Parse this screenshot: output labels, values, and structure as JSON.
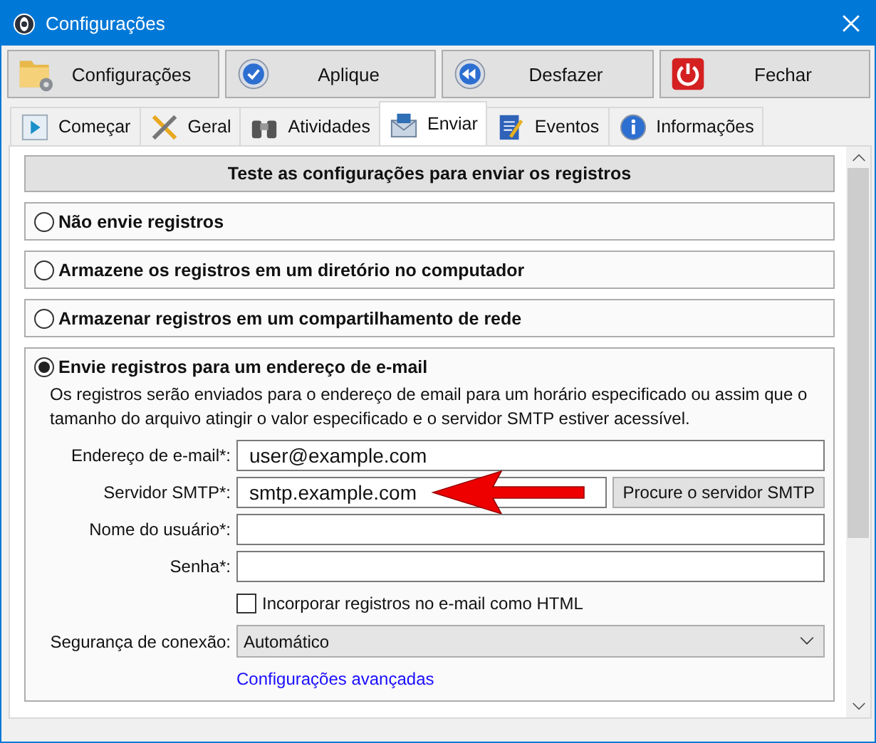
{
  "window": {
    "title": "Configurações"
  },
  "toolbar": [
    {
      "label": "Configurações",
      "kind": "folder"
    },
    {
      "label": "Aplique",
      "kind": "apply"
    },
    {
      "label": "Desfazer",
      "kind": "undo"
    },
    {
      "label": "Fechar",
      "kind": "power"
    }
  ],
  "tabs": [
    {
      "label": "Começar",
      "kind": "play",
      "selected": false
    },
    {
      "label": "Geral",
      "kind": "tools",
      "selected": false
    },
    {
      "label": "Atividades",
      "kind": "binoculars",
      "selected": false
    },
    {
      "label": "Enviar",
      "kind": "mail",
      "selected": true
    },
    {
      "label": "Eventos",
      "kind": "notepad",
      "selected": false
    },
    {
      "label": "Informações",
      "kind": "info",
      "selected": false
    }
  ],
  "test_button": "Teste as configurações para enviar os registros",
  "options": [
    {
      "label": "Não envie registros",
      "selected": false
    },
    {
      "label": "Armazene os registros em um diretório no computador",
      "selected": false
    },
    {
      "label": "Armazenar registros em um compartilhamento de rede",
      "selected": false
    },
    {
      "label": "Envie registros para um endereço de e-mail",
      "selected": true
    }
  ],
  "email": {
    "description": "Os registros serão enviados para o endereço de email para um horário especificado ou assim que o tamanho do arquivo atingir o valor especificado e o servidor SMTP estiver acessível.",
    "fields": [
      {
        "label": "Endereço de e-mail*:",
        "value": "user@example.com"
      },
      {
        "label": "Servidor SMTP*:",
        "value": "smtp.example.com",
        "button": "Procure o servidor SMTP",
        "arrow": true
      },
      {
        "label": "Nome do usuário*:"
      },
      {
        "label": "Senha*:"
      }
    ],
    "checkbox": {
      "label": "Incorporar registros no e-mail como HTML",
      "checked": false
    },
    "security": {
      "label": "Segurança de conexão:",
      "value": "Automático"
    },
    "link": "Configurações avançadas"
  }
}
